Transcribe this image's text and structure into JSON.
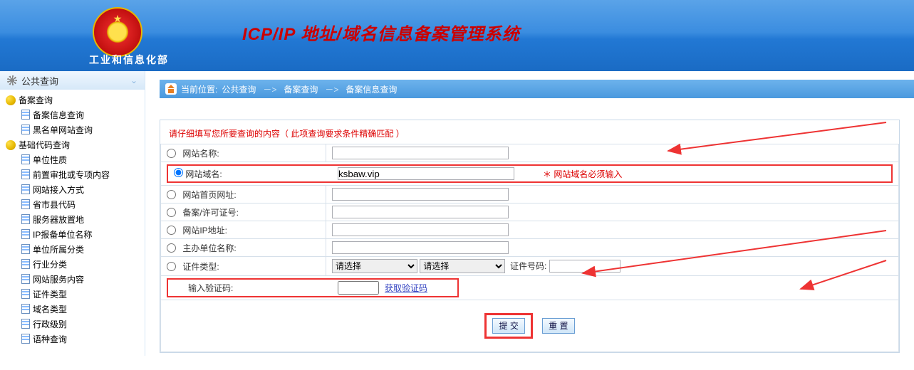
{
  "header": {
    "org_name": "工业和信息化部",
    "system_title": "ICP/IP 地址/域名信息备案管理系统"
  },
  "sidebar": {
    "section_title": "公共查询",
    "groups": [
      {
        "label": "备案查询",
        "children": [
          "备案信息查询",
          "黑名单网站查询"
        ]
      },
      {
        "label": "基础代码查询",
        "children": [
          "单位性质",
          "前置审批或专项内容",
          "网站接入方式",
          "省市县代码",
          "服务器放置地",
          "IP报备单位名称",
          "单位所属分类",
          "行业分类",
          "网站服务内容",
          "证件类型",
          "域名类型",
          "行政级别",
          "语种查询"
        ]
      }
    ]
  },
  "breadcrumb": {
    "label_current": "当前位置:",
    "items": [
      "公共查询",
      "备案查询",
      "备案信息查询"
    ],
    "sep": "－>"
  },
  "form": {
    "hint": "请仔细填写您所要查询的内容（ 此项查询要求条件精确匹配 ）",
    "rows": [
      {
        "name": "site_name",
        "label": "网站名称:"
      },
      {
        "name": "site_domain",
        "label": "网站域名:",
        "value": "ksbaw.vip",
        "hint": "＊ 网站域名必须输入",
        "highlighted": true,
        "checked": true
      },
      {
        "name": "home_url",
        "label": "网站首页网址:"
      },
      {
        "name": "record_no",
        "label": "备案/许可证号:"
      },
      {
        "name": "ip_addr",
        "label": "网站IP地址:"
      },
      {
        "name": "sponsor_name",
        "label": "主办单位名称:"
      },
      {
        "name": "cert_type",
        "label": "证件类型:",
        "select1": "请选择",
        "select2": "请选择",
        "cert_no_label": "证件号码:"
      }
    ],
    "captcha": {
      "label": "输入验证码:",
      "link": "获取验证码"
    },
    "buttons": {
      "submit": "提 交",
      "reset": "重 置"
    }
  }
}
